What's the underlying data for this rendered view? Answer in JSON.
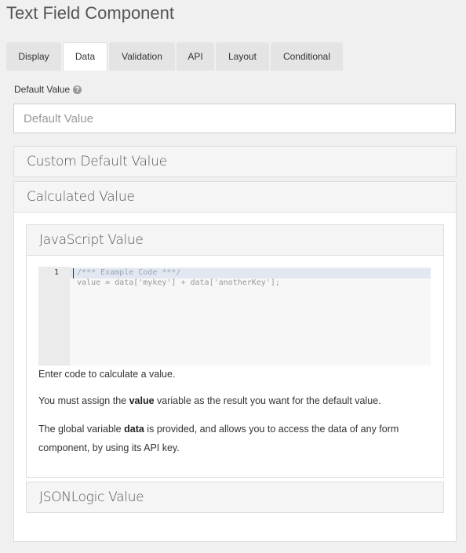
{
  "title": "Text Field Component",
  "tabs": [
    {
      "label": "Display",
      "active": false
    },
    {
      "label": "Data",
      "active": true
    },
    {
      "label": "Validation",
      "active": false
    },
    {
      "label": "API",
      "active": false
    },
    {
      "label": "Layout",
      "active": false
    },
    {
      "label": "Conditional",
      "active": false
    }
  ],
  "default_value": {
    "label": "Default Value",
    "help_icon": "question-circle-icon",
    "placeholder": "Default Value",
    "value": ""
  },
  "custom_default": {
    "label": "Custom Default Value"
  },
  "calculated": {
    "label": "Calculated Value"
  },
  "js_value": {
    "label": "JavaScript Value",
    "code_lines": [
      "/*** Example Code ***/",
      "value = data['mykey'] + data['anotherKey'];"
    ],
    "line_number": "1",
    "hint": "Enter code to calculate a value.",
    "p1_pre": "You must assign the ",
    "p1_bold": "value",
    "p1_post": " variable as the result you want for the default value.",
    "p2_pre": "The global variable ",
    "p2_bold": "data",
    "p2_post": " is provided, and allows you to access the data of any form component, by using its API key."
  },
  "jsonlogic": {
    "label": "JSONLogic Value"
  }
}
